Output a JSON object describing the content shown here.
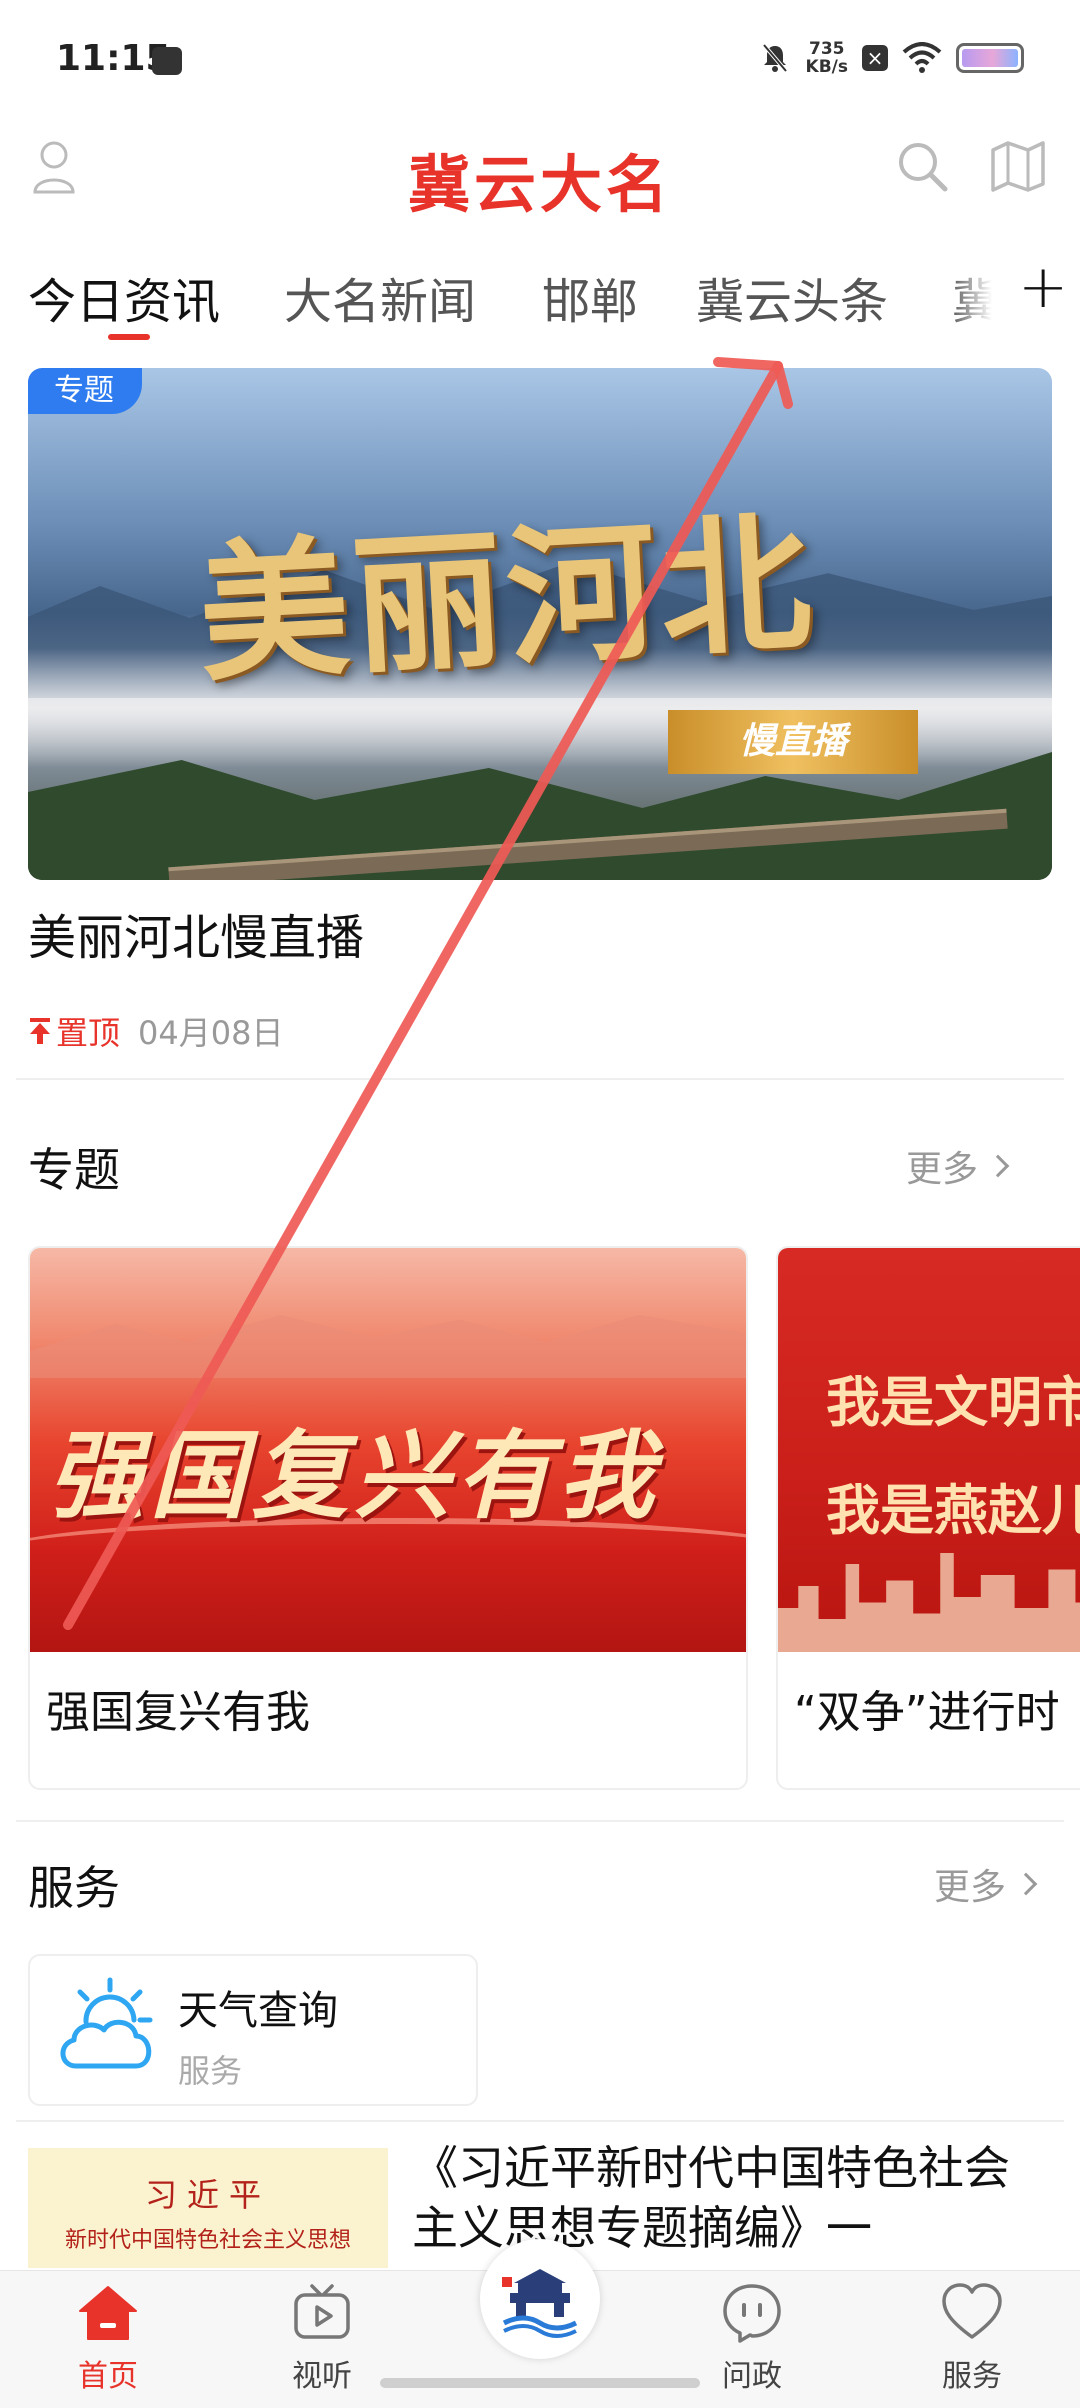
{
  "status_bar": {
    "time": "11:15",
    "speed_value": "735",
    "speed_unit": "KB/s"
  },
  "header": {
    "title": "冀云大名"
  },
  "tabs": [
    {
      "label": "今日资讯",
      "active": true
    },
    {
      "label": "大名新闻"
    },
    {
      "label": "邯郸"
    },
    {
      "label": "冀云头条"
    },
    {
      "label": "冀"
    }
  ],
  "banner": {
    "badge": "专题",
    "calligraphy": "美丽河北",
    "sub_banner": "慢直播",
    "title": "美丽河北慢直播",
    "pin_label": "置顶",
    "date": "04月08日"
  },
  "topics_section": {
    "title": "专题",
    "more": "更多",
    "cards": [
      {
        "image_text": "强国复兴有我",
        "label": "强国复兴有我"
      },
      {
        "image_text_line1": "我是文明市民",
        "image_text_line2": "我是燕赵儿女",
        "label": "“双争”进行时"
      }
    ]
  },
  "services_section": {
    "title": "服务",
    "more": "更多",
    "items": [
      {
        "name": "天气查询",
        "type": "服务"
      }
    ]
  },
  "article": {
    "thumb_line1": "习近平",
    "thumb_line2": "新时代中国特色社会主义思想",
    "title": "《习近平新时代中国特色社会主义思想专题摘编》一"
  },
  "bottom_nav": [
    {
      "label": "首页",
      "active": true
    },
    {
      "label": "视听"
    },
    {
      "label": ""
    },
    {
      "label": "问政"
    },
    {
      "label": "服务"
    }
  ],
  "colors": {
    "brand_red": "#e8332b",
    "badge_blue": "#2e7cf0"
  }
}
